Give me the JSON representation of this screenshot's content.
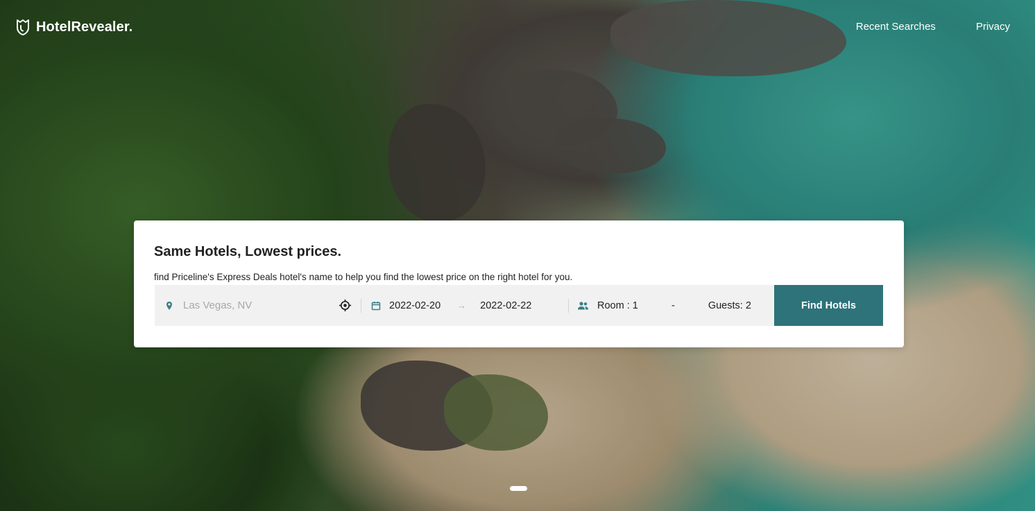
{
  "brand": {
    "name": "HotelRevealer."
  },
  "nav": [
    {
      "label": "Recent Searches"
    },
    {
      "label": "Privacy"
    }
  ],
  "search_card": {
    "title": "Same Hotels, Lowest prices.",
    "subtitle": "find Priceline's Express Deals hotel's name to help you find the lowest price on the right hotel for you.",
    "location_placeholder": "Las Vegas, NV",
    "checkin": "2022-02-20",
    "checkout": "2022-02-22",
    "date_arrow": "→",
    "rooms": "Room : 1",
    "separator": "-",
    "guests": "Guests: 2",
    "submit_label": "Find Hotels"
  },
  "colors": {
    "accent": "#2d7379",
    "icon": "#3a7f85"
  },
  "icons": [
    "shield-logo-icon",
    "map-pin-icon",
    "crosshair-icon",
    "calendar-icon",
    "people-icon"
  ],
  "carousel": {
    "active_index": 1,
    "total": 1
  }
}
